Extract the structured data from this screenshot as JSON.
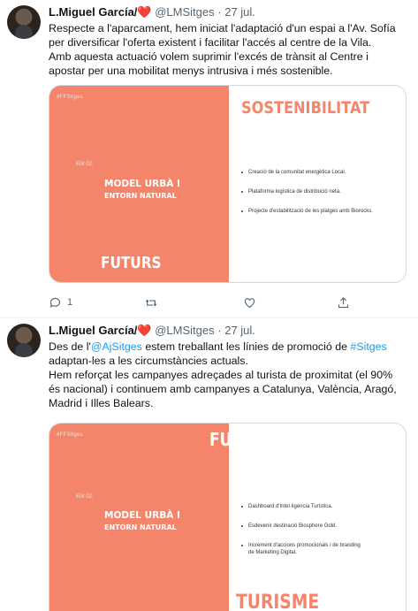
{
  "tweets": [
    {
      "author": "L.Miguel García/",
      "heart": "❤️",
      "handle": "@LMSitges",
      "separator": "·",
      "date": "27 jul.",
      "text_lines": [
        "Respecte a l'aparcament, hem iniciat l'adaptació d'un espai a l'Av. Sofía per diversificar l'oferta existent i facilitar l'accés al centre de la Vila.",
        "Amb aquesta actuació volem suprimir l'excés de trànsit al Centre i apostar per una mobilitat menys intrusiva i més sostenible."
      ],
      "card": {
        "hashtag": "#FFSitges",
        "eix": "EIX 02.",
        "model_line1": "MODEL URBÀ I",
        "model_line2": "ENTORN NATURAL",
        "big_label": "FUTURS",
        "title": "SOSTENIBILITAT",
        "bullets": [
          "Creació de la comunitat energètica Local.",
          "Plataforma logística de distribució neta.",
          "Projecte d'estabilització de les platges amb Biorocks."
        ]
      },
      "actions": {
        "reply_count": "1",
        "retweet_count": "",
        "like_count": ""
      }
    },
    {
      "author": "L.Miguel García/",
      "heart": "❤️",
      "handle": "@LMSitges",
      "separator": "·",
      "date": "27 jul.",
      "text_before_mention": "Des de l'",
      "mention": "@AjSitges",
      "text_after_mention": " estem treballant les línies de promoció de ",
      "hashtag": "#Sitges",
      "text_after_hashtag": " adaptan-les a les circumstàncies actuals.",
      "text_line2": "Hem reforçat les campanyes adreçades al turista de proximitat (el 90% és nacional) i continuem amb campanyes a Catalunya, València, Aragó, Madrid i Illes Balears.",
      "card": {
        "hashtag": "#FFSitges",
        "eix": "EIX 02.",
        "model_line1": "MODEL URBÀ I",
        "model_line2": "ENTORN NATURAL",
        "big_label": "FUTURS",
        "title": "TURISME",
        "bullets": [
          "Dashboard d'Intel·ligència Turística.",
          "Esdevenir destinació Biosphere Gold.",
          "Increment d'accions promocionals i de branding de Marketing Digital."
        ]
      }
    }
  ],
  "colors": {
    "accent_orange": "#f4856a",
    "link_blue": "#1d9bf0",
    "muted_gray": "#536471",
    "heart_red": "#d81f3c"
  }
}
